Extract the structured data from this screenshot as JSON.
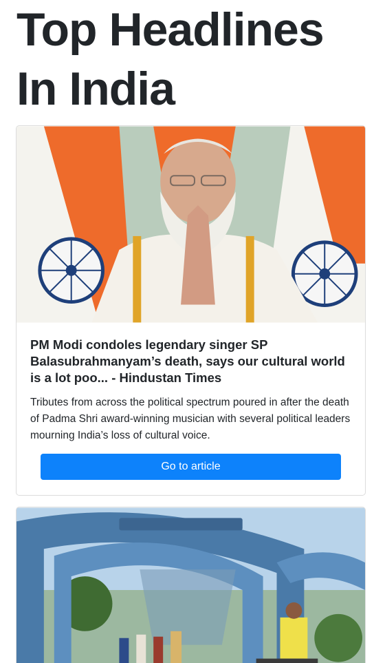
{
  "page": {
    "title": "Top Headlines In India"
  },
  "articles": [
    {
      "image_alt": "PM Modi with folded hands in front of Indian flags",
      "title": "PM Modi condoles legendary singer SP Balasubrahmanyam’s death, says our cultural world is a lot poo... - Hindustan Times",
      "description": "Tributes from across the political spectrum poured in after the death of Padma Shri award-winning musician with several political leaders mourning India’s loss of cultural voice.",
      "button_label": "Go to article"
    },
    {
      "image_alt": "Protest gathering beneath a blue arched gateway",
      "title": "",
      "description": "",
      "button_label": ""
    }
  ]
}
